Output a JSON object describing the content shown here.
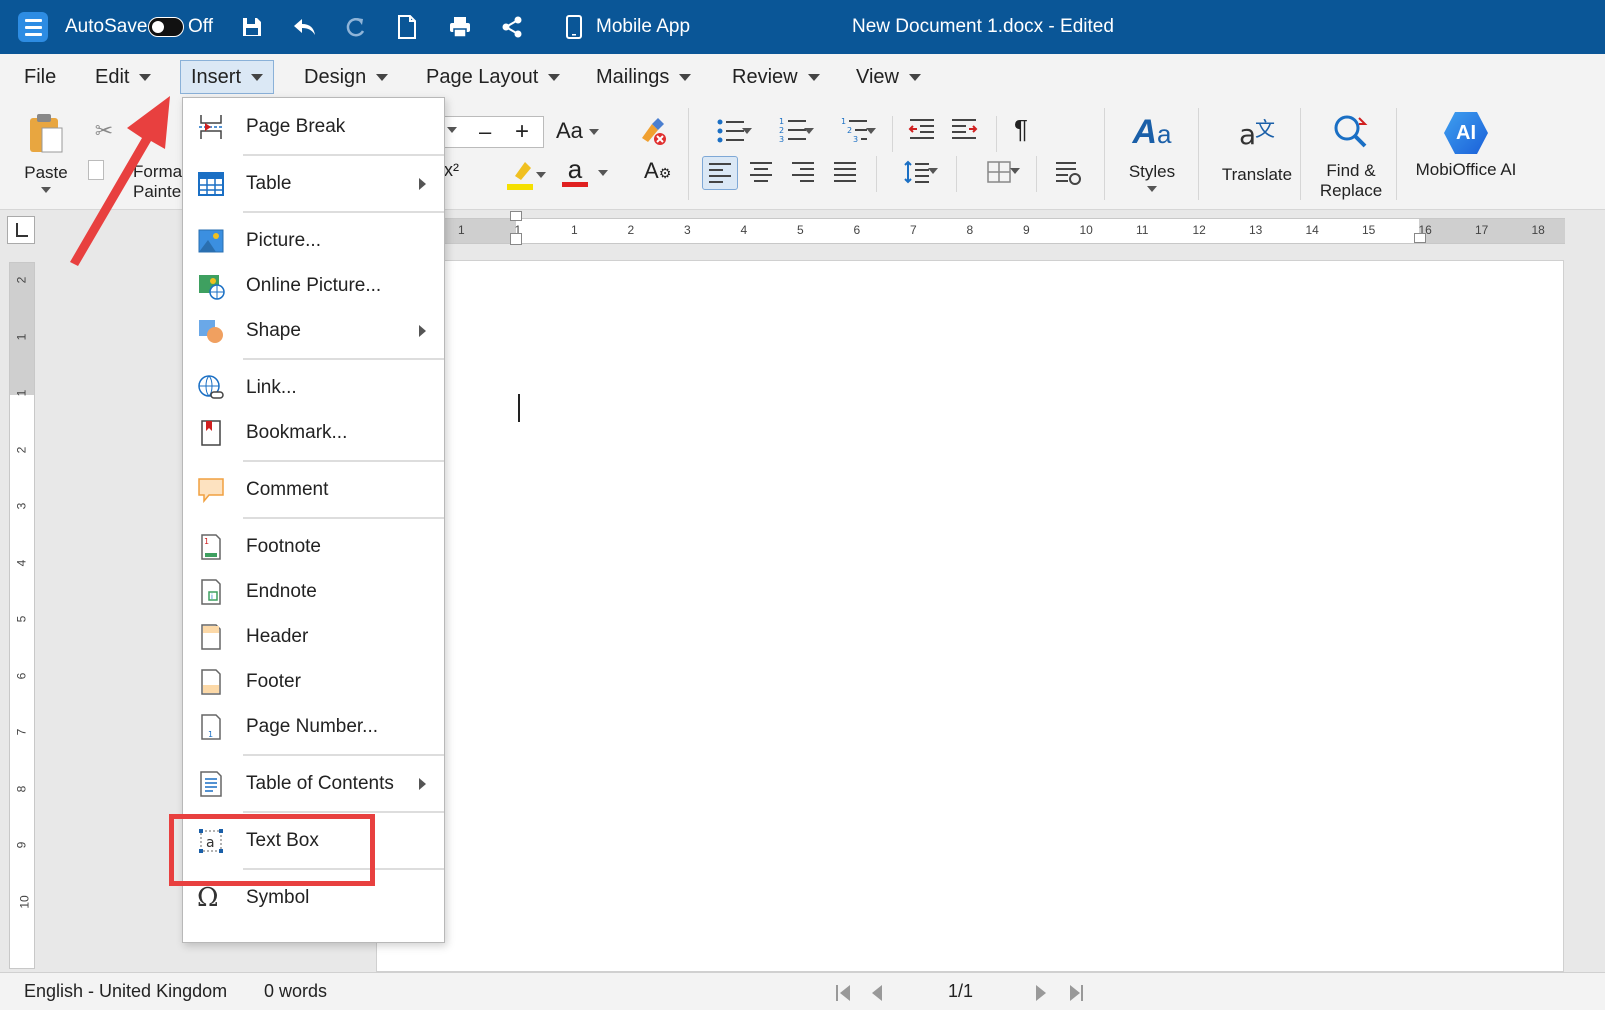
{
  "titlebar": {
    "autosave_label": "AutoSave",
    "autosave_state": "Off",
    "mobile_app_label": "Mobile App",
    "document_title": "New Document 1.docx - Edited"
  },
  "menubar": {
    "items": [
      {
        "label": "File"
      },
      {
        "label": "Edit"
      },
      {
        "label": "Insert"
      },
      {
        "label": "Design"
      },
      {
        "label": "Page Layout"
      },
      {
        "label": "Mailings"
      },
      {
        "label": "Review"
      },
      {
        "label": "View"
      }
    ]
  },
  "ribbon": {
    "paste_label": "Paste",
    "format_painter_label_1": "Format",
    "format_painter_label_2": "Painter",
    "change_case_label": "Aa",
    "superscript_label": "x²",
    "styles_label": "Styles",
    "translate_label": "Translate",
    "find_replace_label_1": "Find &",
    "find_replace_label_2": "Replace",
    "mobioffice_ai_label": "MobiOffice AI",
    "ai_badge": "AI",
    "pilcrow": "¶"
  },
  "ruler": {
    "h_numbers": [
      "1",
      "1",
      "1",
      "2",
      "3",
      "4",
      "5",
      "6",
      "7",
      "8",
      "9",
      "10",
      "11",
      "12",
      "13",
      "14",
      "15",
      "16",
      "17",
      "18"
    ],
    "v_numbers": [
      "2",
      "1",
      "1",
      "2",
      "3",
      "4",
      "5",
      "6",
      "7",
      "8",
      "9",
      "10"
    ]
  },
  "insert_menu": {
    "items": [
      {
        "label": "Page Break",
        "icon": "page-break-icon",
        "submenu": false
      },
      {
        "label": "Table",
        "icon": "table-icon",
        "submenu": true
      },
      {
        "label": "Picture...",
        "icon": "picture-icon",
        "submenu": false
      },
      {
        "label": "Online Picture...",
        "icon": "online-picture-icon",
        "submenu": false
      },
      {
        "label": "Shape",
        "icon": "shape-icon",
        "submenu": true
      },
      {
        "label": "Link...",
        "icon": "link-icon",
        "submenu": false
      },
      {
        "label": "Bookmark...",
        "icon": "bookmark-icon",
        "submenu": false
      },
      {
        "label": "Comment",
        "icon": "comment-icon",
        "submenu": false
      },
      {
        "label": "Footnote",
        "icon": "footnote-icon",
        "submenu": false
      },
      {
        "label": "Endnote",
        "icon": "endnote-icon",
        "submenu": false
      },
      {
        "label": "Header",
        "icon": "header-icon",
        "submenu": false
      },
      {
        "label": "Footer",
        "icon": "footer-icon",
        "submenu": false
      },
      {
        "label": "Page Number...",
        "icon": "page-number-icon",
        "submenu": false
      },
      {
        "label": "Table of Contents",
        "icon": "table-of-contents-icon",
        "submenu": true
      },
      {
        "label": "Text Box",
        "icon": "text-box-icon",
        "submenu": false
      },
      {
        "label": "Symbol",
        "icon": "symbol-icon",
        "submenu": false
      }
    ],
    "textbox_glyph": "a",
    "symbol_glyph": "Ω"
  },
  "statusbar": {
    "language": "English - United Kingdom",
    "word_count": "0 words",
    "page_indicator": "1/1"
  },
  "colors": {
    "titlebar_bg": "#0a5697",
    "highlight_red": "#e8403f",
    "active_menu_bg": "#dbe8f5"
  }
}
